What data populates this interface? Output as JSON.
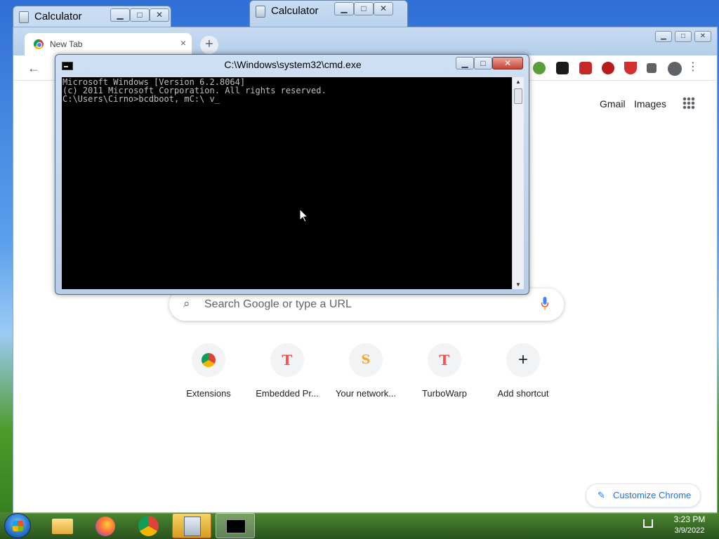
{
  "background_windows": {
    "calc_left_title": "Calculator",
    "calc_right_title": "Calculator"
  },
  "chrome": {
    "tab_title": "New Tab",
    "tab_close": "×",
    "new_tab": "+",
    "back": "←",
    "header_links": {
      "gmail": "Gmail",
      "images": "Images"
    },
    "search": {
      "placeholder": "Search Google or type a URL"
    },
    "shortcuts": [
      {
        "label": "Extensions",
        "icon": "chrome-icon",
        "glyph": ""
      },
      {
        "label": "Embedded Pr...",
        "icon": "turbowarp-icon",
        "glyph": "T"
      },
      {
        "label": "Your network...",
        "icon": "scratch-icon",
        "glyph": "S"
      },
      {
        "label": "TurboWarp",
        "icon": "turbowarp-icon",
        "glyph": "T"
      },
      {
        "label": "Add shortcut",
        "icon": "plus-icon",
        "glyph": "+"
      }
    ],
    "customize_label": "Customize Chrome",
    "accent_color": "#1a73e8"
  },
  "cmd": {
    "title": "C:\\Windows\\system32\\cmd.exe",
    "lines": [
      "Microsoft Windows [Version 6.2.8064]",
      "(c) 2011 Microsoft Corporation. All rights reserved.",
      "",
      "C:\\Users\\Cirno>bcdboot, mC:\\ v_"
    ]
  },
  "window_controls": {
    "minimize": "▁",
    "maximize": "□",
    "close": "✕"
  },
  "taskbar": {
    "pinned": [
      "file-explorer-icon",
      "firefox-icon",
      "chrome-icon",
      "calculator-icon",
      "cmd-icon"
    ],
    "clock_time": "3:23 PM",
    "clock_date": "3/9/2022"
  }
}
